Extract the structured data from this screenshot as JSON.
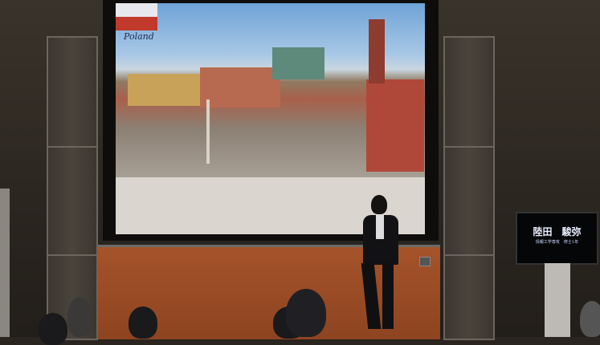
{
  "slide": {
    "country_label": "Poland"
  },
  "name_monitor": {
    "name": "陸田　駿弥",
    "affiliation": "情報工学専攻　修士1年"
  },
  "colors": {
    "flag_red": "#c0392b",
    "stage_wood": "#a5532a"
  }
}
